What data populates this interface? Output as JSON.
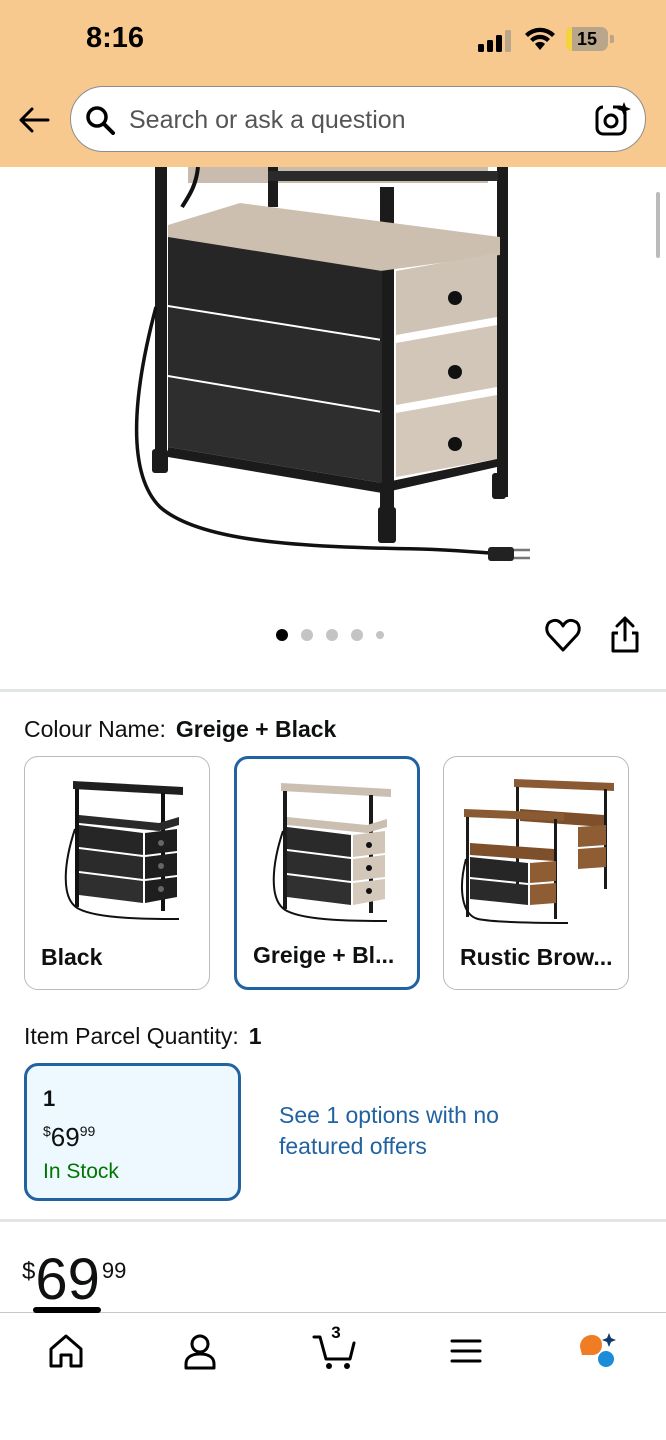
{
  "status_bar": {
    "time": "8:16",
    "battery": "15",
    "battery_level": 0.15
  },
  "search": {
    "placeholder": "Search or ask a question"
  },
  "gallery": {
    "image_count": 5,
    "active_index": 0
  },
  "colour": {
    "label": "Colour Name:",
    "selected": "Greige + Black",
    "options": [
      {
        "label": "Black",
        "selected": false
      },
      {
        "label": "Greige + Bl...",
        "selected": true
      },
      {
        "label": "Rustic Brow...",
        "selected": false
      }
    ]
  },
  "quantity": {
    "label": "Item Parcel Quantity:",
    "selected": "1",
    "card": {
      "qty": "1",
      "currency": "$",
      "whole": "69",
      "fraction": "99",
      "stock": "In Stock"
    },
    "see_options": "See 1 options with no featured offers"
  },
  "price": {
    "currency": "$",
    "whole": "69",
    "fraction": "99"
  },
  "cart": {
    "count": "3"
  },
  "colors": {
    "header_bg": "#f7c98f",
    "accent": "#2162a1",
    "in_stock": "#007600",
    "rufus": "#f07c24"
  }
}
